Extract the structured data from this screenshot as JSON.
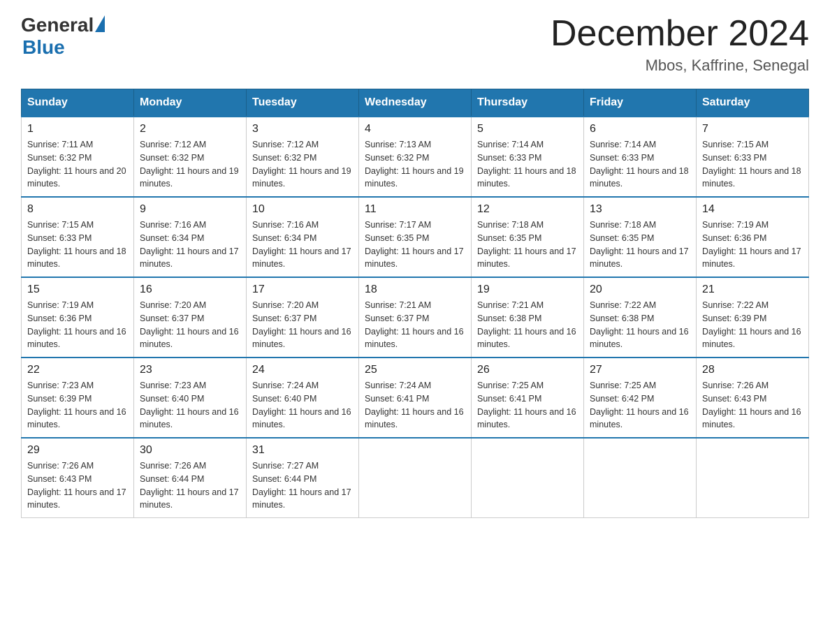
{
  "header": {
    "logo_general": "General",
    "logo_blue": "Blue",
    "title": "December 2024",
    "subtitle": "Mbos, Kaffrine, Senegal"
  },
  "days_of_week": [
    "Sunday",
    "Monday",
    "Tuesday",
    "Wednesday",
    "Thursday",
    "Friday",
    "Saturday"
  ],
  "weeks": [
    [
      {
        "day": "1",
        "sunrise": "7:11 AM",
        "sunset": "6:32 PM",
        "daylight": "11 hours and 20 minutes."
      },
      {
        "day": "2",
        "sunrise": "7:12 AM",
        "sunset": "6:32 PM",
        "daylight": "11 hours and 19 minutes."
      },
      {
        "day": "3",
        "sunrise": "7:12 AM",
        "sunset": "6:32 PM",
        "daylight": "11 hours and 19 minutes."
      },
      {
        "day": "4",
        "sunrise": "7:13 AM",
        "sunset": "6:32 PM",
        "daylight": "11 hours and 19 minutes."
      },
      {
        "day": "5",
        "sunrise": "7:14 AM",
        "sunset": "6:33 PM",
        "daylight": "11 hours and 18 minutes."
      },
      {
        "day": "6",
        "sunrise": "7:14 AM",
        "sunset": "6:33 PM",
        "daylight": "11 hours and 18 minutes."
      },
      {
        "day": "7",
        "sunrise": "7:15 AM",
        "sunset": "6:33 PM",
        "daylight": "11 hours and 18 minutes."
      }
    ],
    [
      {
        "day": "8",
        "sunrise": "7:15 AM",
        "sunset": "6:33 PM",
        "daylight": "11 hours and 18 minutes."
      },
      {
        "day": "9",
        "sunrise": "7:16 AM",
        "sunset": "6:34 PM",
        "daylight": "11 hours and 17 minutes."
      },
      {
        "day": "10",
        "sunrise": "7:16 AM",
        "sunset": "6:34 PM",
        "daylight": "11 hours and 17 minutes."
      },
      {
        "day": "11",
        "sunrise": "7:17 AM",
        "sunset": "6:35 PM",
        "daylight": "11 hours and 17 minutes."
      },
      {
        "day": "12",
        "sunrise": "7:18 AM",
        "sunset": "6:35 PM",
        "daylight": "11 hours and 17 minutes."
      },
      {
        "day": "13",
        "sunrise": "7:18 AM",
        "sunset": "6:35 PM",
        "daylight": "11 hours and 17 minutes."
      },
      {
        "day": "14",
        "sunrise": "7:19 AM",
        "sunset": "6:36 PM",
        "daylight": "11 hours and 17 minutes."
      }
    ],
    [
      {
        "day": "15",
        "sunrise": "7:19 AM",
        "sunset": "6:36 PM",
        "daylight": "11 hours and 16 minutes."
      },
      {
        "day": "16",
        "sunrise": "7:20 AM",
        "sunset": "6:37 PM",
        "daylight": "11 hours and 16 minutes."
      },
      {
        "day": "17",
        "sunrise": "7:20 AM",
        "sunset": "6:37 PM",
        "daylight": "11 hours and 16 minutes."
      },
      {
        "day": "18",
        "sunrise": "7:21 AM",
        "sunset": "6:37 PM",
        "daylight": "11 hours and 16 minutes."
      },
      {
        "day": "19",
        "sunrise": "7:21 AM",
        "sunset": "6:38 PM",
        "daylight": "11 hours and 16 minutes."
      },
      {
        "day": "20",
        "sunrise": "7:22 AM",
        "sunset": "6:38 PM",
        "daylight": "11 hours and 16 minutes."
      },
      {
        "day": "21",
        "sunrise": "7:22 AM",
        "sunset": "6:39 PM",
        "daylight": "11 hours and 16 minutes."
      }
    ],
    [
      {
        "day": "22",
        "sunrise": "7:23 AM",
        "sunset": "6:39 PM",
        "daylight": "11 hours and 16 minutes."
      },
      {
        "day": "23",
        "sunrise": "7:23 AM",
        "sunset": "6:40 PM",
        "daylight": "11 hours and 16 minutes."
      },
      {
        "day": "24",
        "sunrise": "7:24 AM",
        "sunset": "6:40 PM",
        "daylight": "11 hours and 16 minutes."
      },
      {
        "day": "25",
        "sunrise": "7:24 AM",
        "sunset": "6:41 PM",
        "daylight": "11 hours and 16 minutes."
      },
      {
        "day": "26",
        "sunrise": "7:25 AM",
        "sunset": "6:41 PM",
        "daylight": "11 hours and 16 minutes."
      },
      {
        "day": "27",
        "sunrise": "7:25 AM",
        "sunset": "6:42 PM",
        "daylight": "11 hours and 16 minutes."
      },
      {
        "day": "28",
        "sunrise": "7:26 AM",
        "sunset": "6:43 PM",
        "daylight": "11 hours and 16 minutes."
      }
    ],
    [
      {
        "day": "29",
        "sunrise": "7:26 AM",
        "sunset": "6:43 PM",
        "daylight": "11 hours and 17 minutes."
      },
      {
        "day": "30",
        "sunrise": "7:26 AM",
        "sunset": "6:44 PM",
        "daylight": "11 hours and 17 minutes."
      },
      {
        "day": "31",
        "sunrise": "7:27 AM",
        "sunset": "6:44 PM",
        "daylight": "11 hours and 17 minutes."
      },
      null,
      null,
      null,
      null
    ]
  ]
}
